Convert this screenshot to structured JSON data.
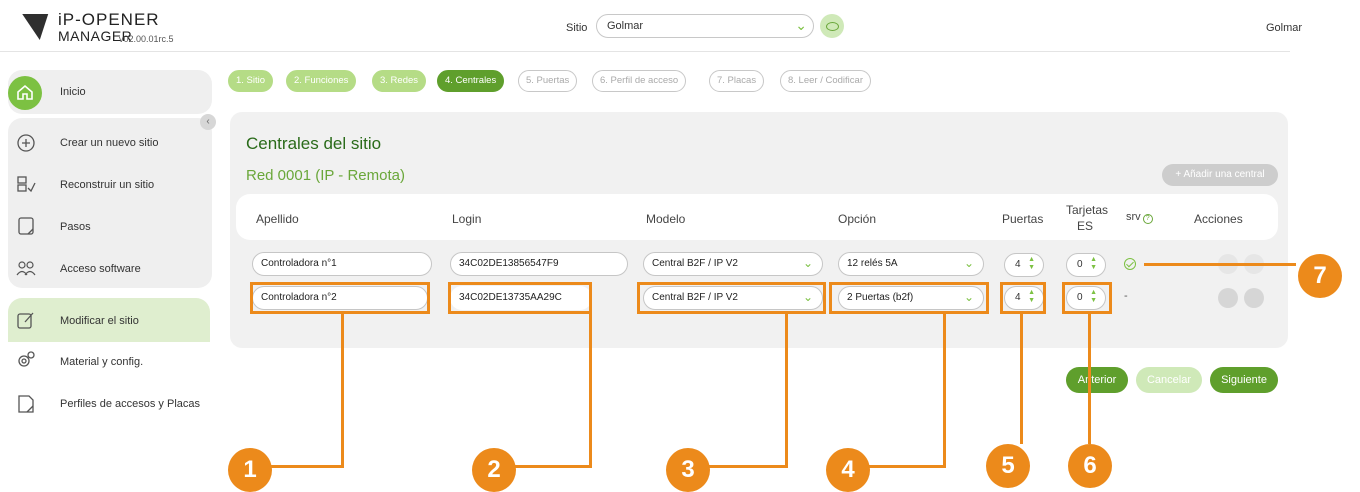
{
  "header": {
    "logo_title": "iP-OPENER",
    "logo_subtitle": "MANAGER",
    "version": "v02.00.01rc.5",
    "site_label": "Sitio",
    "site_value": "Golmar",
    "user_name": "Golmar"
  },
  "sidebar": {
    "items": [
      {
        "label": "Inicio",
        "icon": "home-icon"
      },
      {
        "label": "Crear un nuevo sitio",
        "icon": "plus-circle-icon"
      },
      {
        "label": "Reconstruir un sitio",
        "icon": "rebuild-icon"
      },
      {
        "label": "Pasos",
        "icon": "steps-icon"
      },
      {
        "label": "Acceso software",
        "icon": "users-icon"
      },
      {
        "label": "Modificar el sitio",
        "icon": "edit-icon"
      },
      {
        "label": "Material y config.",
        "icon": "gears-icon"
      },
      {
        "label": "Perfiles de accesos y Placas",
        "icon": "profile-card-icon"
      }
    ]
  },
  "steps": [
    {
      "label": "1. Sitio",
      "state": "done"
    },
    {
      "label": "2. Funciones",
      "state": "done"
    },
    {
      "label": "3. Redes",
      "state": "done"
    },
    {
      "label": "4. Centrales",
      "state": "current"
    },
    {
      "label": "5. Puertas",
      "state": "todo"
    },
    {
      "label": "6. Perfil de acceso",
      "state": "todo"
    },
    {
      "label": "7. Placas",
      "state": "todo"
    },
    {
      "label": "8. Leer / Codificar",
      "state": "todo"
    }
  ],
  "main": {
    "title": "Centrales del sitio",
    "network_title": "Red 0001 (IP - Remota)",
    "add_button": "Añadir una central",
    "columns": {
      "apellido": "Apellido",
      "login": "Login",
      "modelo": "Modelo",
      "opcion": "Opción",
      "puertas": "Puertas",
      "tarjetas": "Tarjetas",
      "tarjetas_es": "ES",
      "srv": "srv",
      "acciones": "Acciones"
    },
    "rows": [
      {
        "apellido": "Controladora n°1",
        "login": "34C02DE13856547F9",
        "modelo": "Central B2F / IP V2",
        "opcion": "12 relés 5A",
        "puertas": "4",
        "tarjetas": "0",
        "srv": "ok"
      },
      {
        "apellido": "Controladora n°2",
        "login": "34C02DE13735AA29C",
        "modelo": "Central B2F / IP V2",
        "opcion": "2 Puertas (b2f)",
        "puertas": "4",
        "tarjetas": "0",
        "srv": "-"
      }
    ],
    "buttons": {
      "previous": "Anterior",
      "cancel": "Cancelar",
      "next": "Siguiente"
    }
  },
  "callouts": [
    "1",
    "2",
    "3",
    "4",
    "5",
    "6",
    "7"
  ],
  "colors": {
    "accent": "#7cc142",
    "dark_green": "#2a6b1a",
    "callout": "#ec8a1b"
  }
}
